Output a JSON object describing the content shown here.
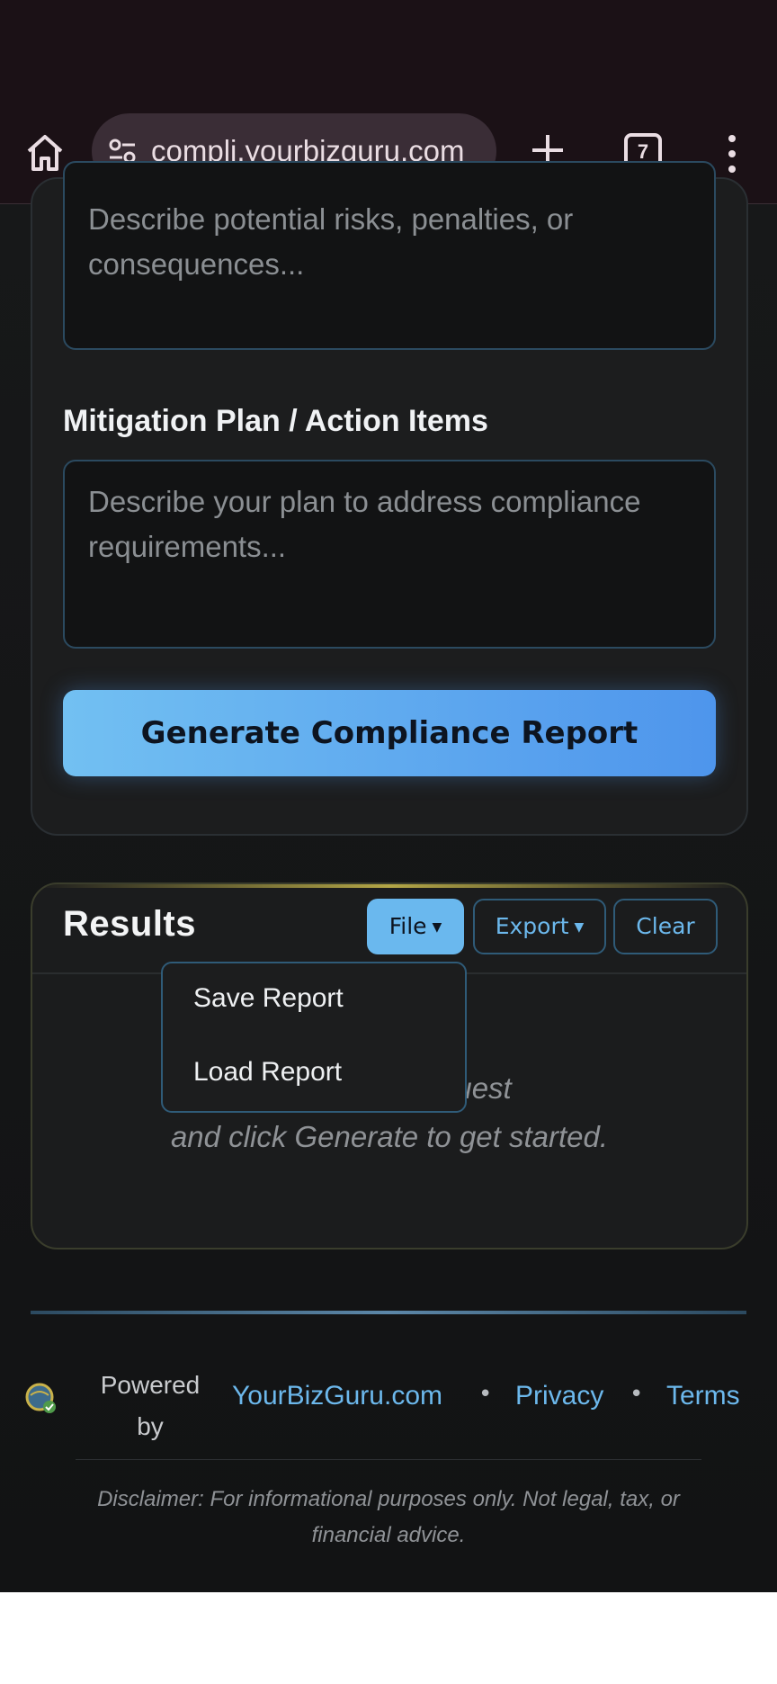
{
  "browser": {
    "url": "compli.yourbizguru.com",
    "tab_count": "7"
  },
  "form": {
    "risks_placeholder": "Describe potential risks, penalties, or consequences...",
    "mitigation_label": "Mitigation Plan / Action Items",
    "mitigation_placeholder": "Describe your plan to address compliance requirements...",
    "generate_button": "Generate Compliance Report"
  },
  "results": {
    "title": "Results",
    "file_button": "File",
    "export_button": "Export",
    "clear_button": "Clear",
    "empty_line1": "Enter your request",
    "empty_line2": "and click Generate to get started."
  },
  "file_menu": {
    "items": [
      {
        "label": "Save Report"
      },
      {
        "label": "Load Report"
      }
    ]
  },
  "footer": {
    "powered_by": "Powered by",
    "site_link": "YourBizGuru.com",
    "privacy_link": "Privacy",
    "terms_link": "Terms",
    "separator": "•",
    "disclaimer": "Disclaimer: For informational purposes only. Not legal, tax, or financial advice."
  },
  "colors": {
    "accent": "#6ab8ee",
    "background": "#171819",
    "browser_bar": "#1b1116"
  }
}
